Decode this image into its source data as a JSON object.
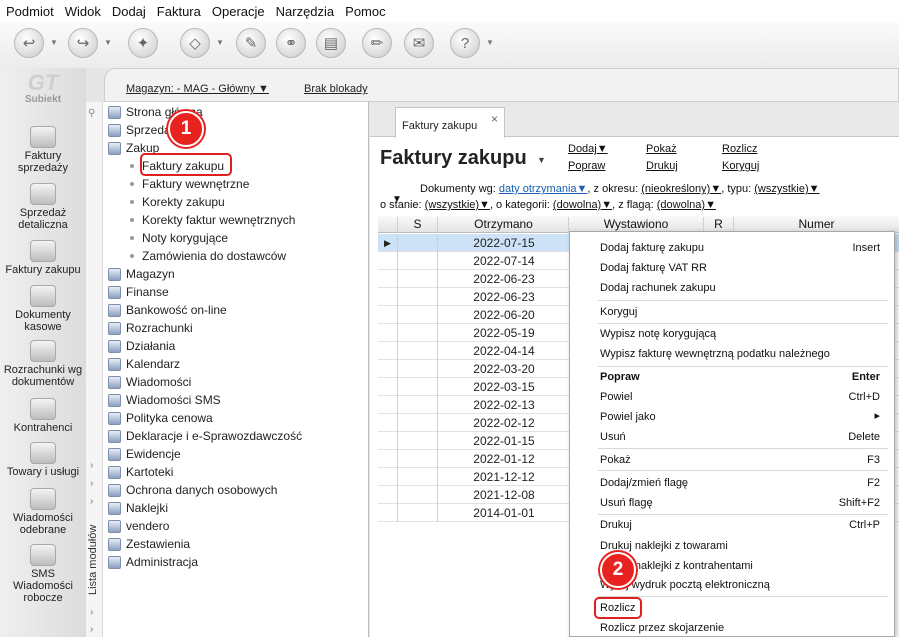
{
  "menubar": [
    "Podmiot",
    "Widok",
    "Dodaj",
    "Faktura",
    "Operacje",
    "Narzędzia",
    "Pomoc"
  ],
  "logo": {
    "mark": "GT",
    "word": "Subiekt"
  },
  "leftbar": [
    {
      "label": "Faktury sprzedaży",
      "icon": "coins-icon"
    },
    {
      "label": "Sprzedaż detaliczna",
      "icon": "cash-register-icon"
    },
    {
      "label": "Faktury zakupu",
      "icon": "invoice-icon"
    },
    {
      "label": "Dokumenty kasowe",
      "icon": "cash-document-icon"
    },
    {
      "label": "Rozrachunki wg dokumentów",
      "icon": "settlements-icon"
    },
    {
      "label": "Kontrahenci",
      "icon": "contractor-icon"
    },
    {
      "label": "Towary i usługi",
      "icon": "goods-icon"
    },
    {
      "label": "Wiadomości odebrane",
      "icon": "inbox-icon"
    },
    {
      "label": "SMS Wiadomości robocze",
      "icon": "sms-icon"
    }
  ],
  "magbar": {
    "magazyn": "Magazyn: - MAG - Główny",
    "brak": "Brak blokady"
  },
  "modules": {
    "side_label": "Lista modułów",
    "items": [
      "Strona główna",
      "Sprzedaż",
      "Zakup",
      "Magazyn",
      "Finanse",
      "Bankowość on-line",
      "Rozrachunki",
      "Działania",
      "Kalendarz",
      "Wiadomości",
      "Wiadomości SMS",
      "Polityka cenowa",
      "Deklaracje i e-Sprawozdawczość",
      "Ewidencje",
      "Kartoteki",
      "Ochrona danych osobowych",
      "Naklejki",
      "vendero",
      "Zestawienia",
      "Administracja"
    ],
    "sub_items": [
      "Faktury zakupu",
      "Faktury wewnętrzne",
      "Korekty zakupu",
      "Korekty faktur wewnętrznych",
      "Noty korygujące",
      "Zamówienia do dostawców"
    ]
  },
  "badges": {
    "one": "1",
    "two": "2"
  },
  "tab": {
    "label": "Faktury zakupu",
    "close": "×"
  },
  "title": "Faktury zakupu",
  "actions": {
    "dodaj": "Dodaj",
    "popraw": "Popraw",
    "pokaz": "Pokaż",
    "drukuj": "Drukuj",
    "rozlicz": "Rozlicz",
    "koryguj": "Koryguj"
  },
  "filters": {
    "dokumenty_wg": "Dokumenty wg:",
    "dokumenty_val": "daty otrzymania",
    "okres": ", z okresu:",
    "okres_val": "(nieokreślony)",
    "typ": ", typu:",
    "typ_val": "(wszystkie)",
    "stan": "o stanie:",
    "stan_val": "(wszystkie)",
    "kategoria": ", o kategorii:",
    "kategoria_val": "(dowolna)",
    "flaga": ", z flagą:",
    "flaga_val": "(dowolna)"
  },
  "grid": {
    "headers": [
      "S",
      "Otrzymano",
      "Wystawiono",
      "R",
      "Numer"
    ],
    "dates": [
      "2022-07-15",
      "2022-07-14",
      "2022-06-23",
      "2022-06-23",
      "2022-06-20",
      "2022-05-19",
      "2022-04-14",
      "2022-03-20",
      "2022-03-15",
      "2022-02-13",
      "2022-02-12",
      "2022-01-15",
      "2022-01-12",
      "2021-12-12",
      "2021-12-08",
      "2014-01-01"
    ]
  },
  "context_menu": [
    {
      "label": "Dodaj fakturę zakupu",
      "shortcut": "Insert"
    },
    {
      "label": "Dodaj fakturę VAT RR",
      "shortcut": ""
    },
    {
      "label": "Dodaj rachunek zakupu",
      "shortcut": ""
    },
    {
      "label": "Koryguj",
      "shortcut": ""
    },
    {
      "label": "Wypisz notę korygującą",
      "shortcut": ""
    },
    {
      "label": "Wypisz fakturę wewnętrzną podatku należnego",
      "shortcut": ""
    },
    {
      "label": "Popraw",
      "shortcut": "Enter"
    },
    {
      "label": "Powiel",
      "shortcut": "Ctrl+D"
    },
    {
      "label": "Powiel jako",
      "shortcut": "▸"
    },
    {
      "label": "Usuń",
      "shortcut": "Delete"
    },
    {
      "label": "Pokaż",
      "shortcut": "F3"
    },
    {
      "label": "Dodaj/zmień flagę",
      "shortcut": "F2"
    },
    {
      "label": "Usuń flagę",
      "shortcut": "Shift+F2"
    },
    {
      "label": "Drukuj",
      "shortcut": "Ctrl+P"
    },
    {
      "label": "Drukuj naklejki z towarami",
      "shortcut": ""
    },
    {
      "label": "Drukuj naklejki z kontrahentami",
      "shortcut": ""
    },
    {
      "label": "Wyślij wydruk pocztą elektroniczną",
      "shortcut": ""
    },
    {
      "label": "Rozlicz",
      "shortcut": ""
    },
    {
      "label": "Rozlicz przez skojarzenie",
      "shortcut": ""
    }
  ],
  "colors": {
    "highlight": "#e02020",
    "selected_row": "#cde2f6",
    "link": "#1a5fb4"
  }
}
